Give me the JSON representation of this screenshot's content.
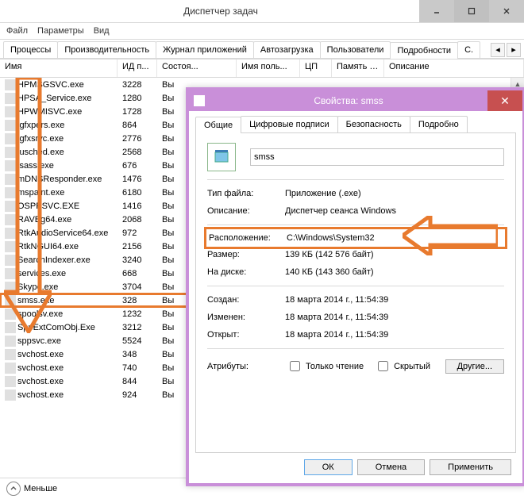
{
  "taskmgr": {
    "title": "Диспетчер задач",
    "menu": {
      "file": "Файл",
      "options": "Параметры",
      "view": "Вид"
    },
    "tabs": [
      "Процессы",
      "Производительность",
      "Журнал приложений",
      "Автозагрузка",
      "Пользователи",
      "Подробности"
    ],
    "active_tab_index": 5,
    "tab_overflow": "С.",
    "headers": {
      "name": "Имя",
      "pid": "ИД п...",
      "state": "Состоя...",
      "user": "Имя поль...",
      "cpu": "ЦП",
      "mem": "Память (ч...",
      "desc": "Описание"
    },
    "less_btn": "Меньше",
    "rows": [
      {
        "name": "HPMSGSVC.exe",
        "pid": "3228",
        "state": "Вы"
      },
      {
        "name": "HPSA_Service.exe",
        "pid": "1280",
        "state": "Вы"
      },
      {
        "name": "HPWMISVC.exe",
        "pid": "1728",
        "state": "Вы"
      },
      {
        "name": "igfxpers.exe",
        "pid": "864",
        "state": "Вы"
      },
      {
        "name": "igfxsrvc.exe",
        "pid": "2776",
        "state": "Вы"
      },
      {
        "name": "jusched.exe",
        "pid": "2568",
        "state": "Вы"
      },
      {
        "name": "lsass.exe",
        "pid": "676",
        "state": "Вы"
      },
      {
        "name": "mDNSResponder.exe",
        "pid": "1476",
        "state": "Вы"
      },
      {
        "name": "mspaint.exe",
        "pid": "6180",
        "state": "Вы"
      },
      {
        "name": "OSPPSVC.EXE",
        "pid": "1416",
        "state": "Вы"
      },
      {
        "name": "RAVBg64.exe",
        "pid": "2068",
        "state": "Вы"
      },
      {
        "name": "RtkAudioService64.exe",
        "pid": "972",
        "state": "Вы"
      },
      {
        "name": "RtkNGUI64.exe",
        "pid": "2156",
        "state": "Вы"
      },
      {
        "name": "SearchIndexer.exe",
        "pid": "3240",
        "state": "Вы"
      },
      {
        "name": "services.exe",
        "pid": "668",
        "state": "Вы"
      },
      {
        "name": "Skype.exe",
        "pid": "3704",
        "state": "Вы"
      },
      {
        "name": "smss.exe",
        "pid": "328",
        "state": "Вы",
        "selected": true
      },
      {
        "name": "spoolsv.exe",
        "pid": "1232",
        "state": "Вы"
      },
      {
        "name": "SppExtComObj.Exe",
        "pid": "3212",
        "state": "Вы"
      },
      {
        "name": "sppsvc.exe",
        "pid": "5524",
        "state": "Вы"
      },
      {
        "name": "svchost.exe",
        "pid": "348",
        "state": "Вы"
      },
      {
        "name": "svchost.exe",
        "pid": "740",
        "state": "Вы"
      },
      {
        "name": "svchost.exe",
        "pid": "844",
        "state": "Вы"
      },
      {
        "name": "svchost.exe",
        "pid": "924",
        "state": "Вы"
      }
    ]
  },
  "props": {
    "title": "Свойства: smss",
    "tabs": [
      "Общие",
      "Цифровые подписи",
      "Безопасность",
      "Подробно"
    ],
    "filename": "smss",
    "fields": {
      "type_k": "Тип файла:",
      "type_v": "Приложение (.exe)",
      "desc_k": "Описание:",
      "desc_v": "Диспетчер сеанса  Windows",
      "loc_k": "Расположение:",
      "loc_v": "C:\\Windows\\System32",
      "size_k": "Размер:",
      "size_v": "139 КБ (142 576 байт)",
      "disk_k": "На диске:",
      "disk_v": "140 КБ (143 360 байт)",
      "created_k": "Создан:",
      "created_v": "18 марта 2014 г., 11:54:39",
      "mod_k": "Изменен:",
      "mod_v": "18 марта 2014 г., 11:54:39",
      "open_k": "Открыт:",
      "open_v": "18 марта 2014 г., 11:54:39",
      "attr_k": "Атрибуты:",
      "ro": "Только чтение",
      "hidden": "Скрытый"
    },
    "buttons": {
      "other": "Другие...",
      "ok": "ОК",
      "cancel": "Отмена",
      "apply": "Применить"
    }
  }
}
